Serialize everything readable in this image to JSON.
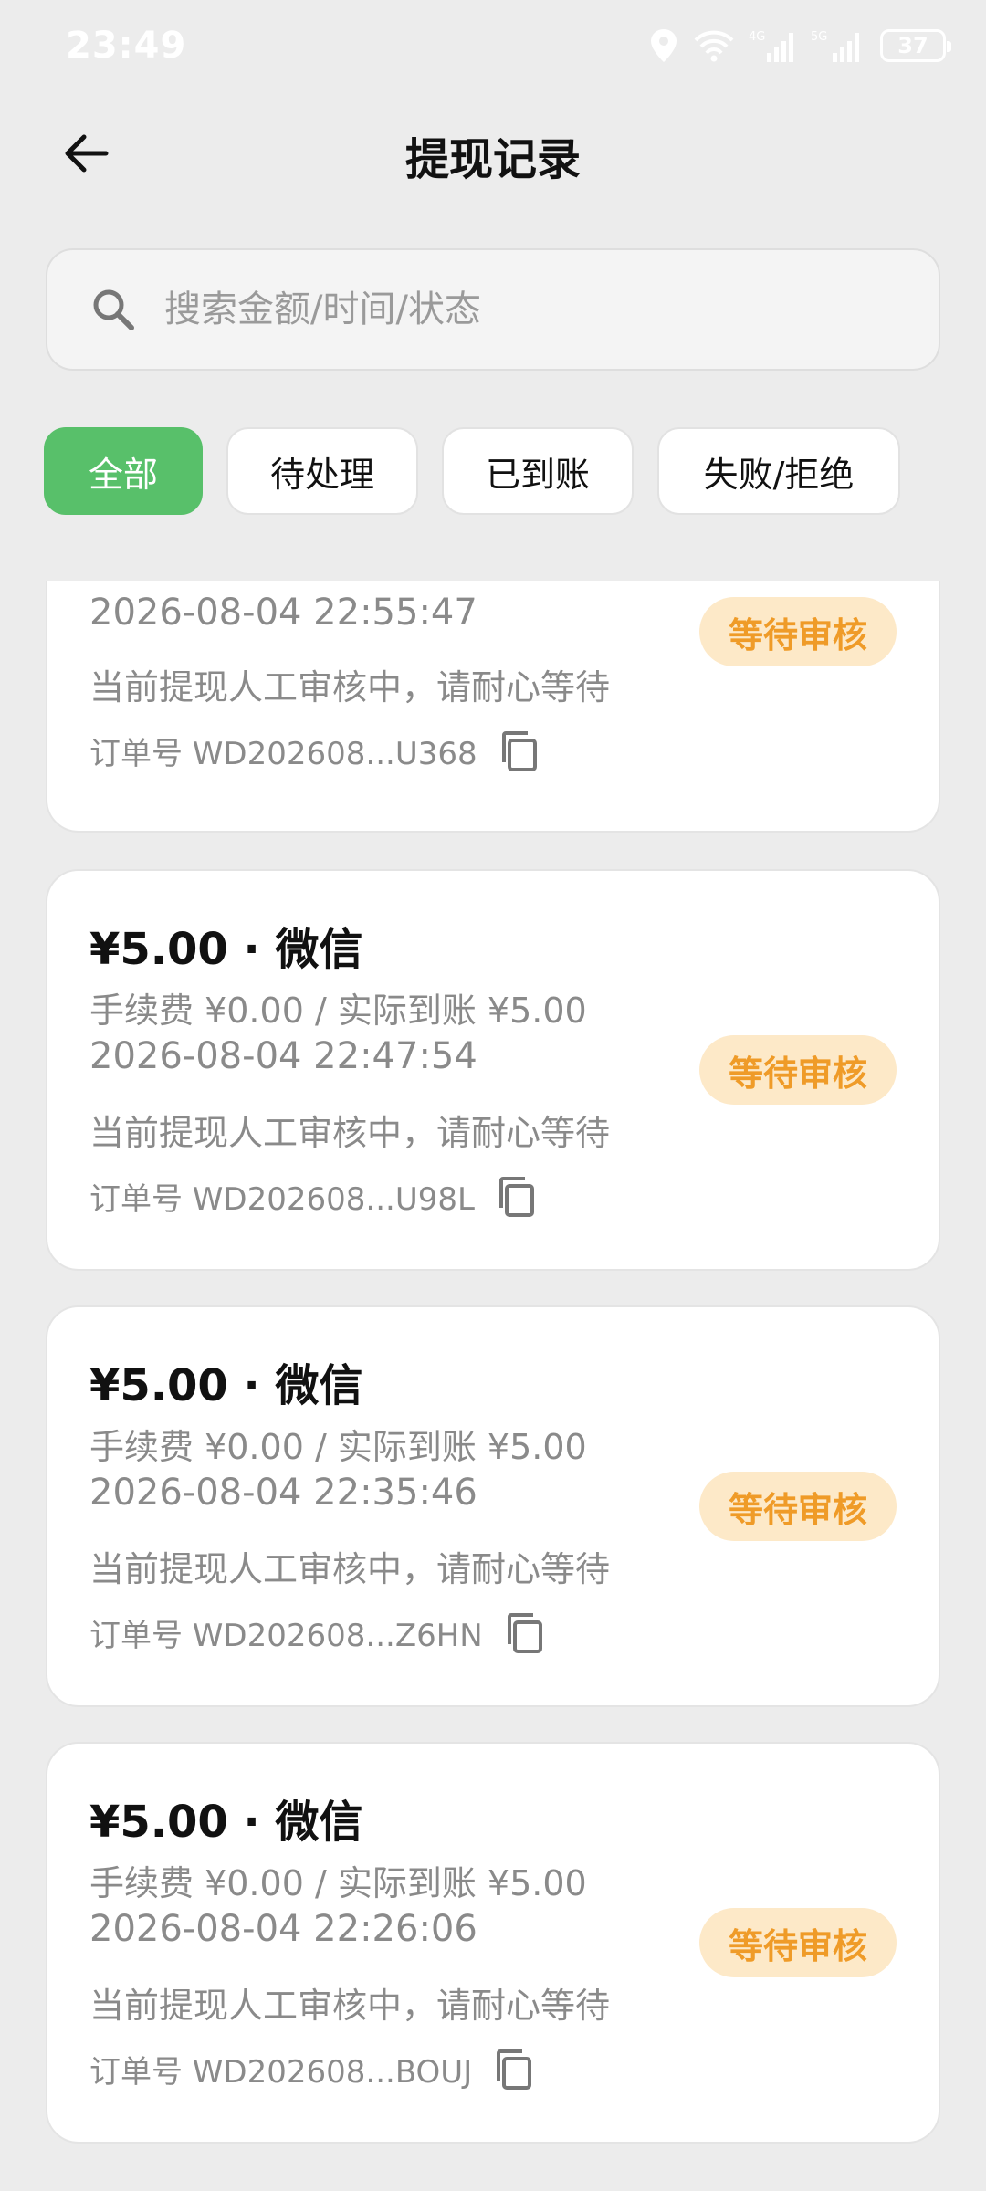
{
  "status_bar": {
    "time": "23:49",
    "battery": "37",
    "icons": [
      "location-icon",
      "wifi-icon",
      "signal-4g-icon",
      "signal-5g-icon",
      "battery-icon"
    ]
  },
  "header": {
    "title": "提现记录",
    "back_icon": "arrow-left-icon"
  },
  "search": {
    "placeholder": "搜索金额/时间/状态",
    "value": ""
  },
  "filters": [
    {
      "label": "全部",
      "active": true
    },
    {
      "label": "待处理",
      "active": false
    },
    {
      "label": "已到账",
      "active": false
    },
    {
      "label": "失败/拒绝",
      "active": false
    }
  ],
  "records": [
    {
      "amount_line": "",
      "fee_line": "",
      "datetime": "2026-08-04 22:55:47",
      "note": "当前提现人工审核中，请耐心等待",
      "order": "订单号 WD202608...U368",
      "status": "等待审核"
    },
    {
      "amount_line": "¥5.00 · 微信",
      "fee_line": "手续费 ¥0.00 / 实际到账 ¥5.00",
      "datetime": "2026-08-04 22:47:54",
      "note": "当前提现人工审核中，请耐心等待",
      "order": "订单号 WD202608...U98L",
      "status": "等待审核"
    },
    {
      "amount_line": "¥5.00 · 微信",
      "fee_line": "手续费 ¥0.00 / 实际到账 ¥5.00",
      "datetime": "2026-08-04 22:35:46",
      "note": "当前提现人工审核中，请耐心等待",
      "order": "订单号 WD202608...Z6HN",
      "status": "等待审核"
    },
    {
      "amount_line": "¥5.00 · 微信",
      "fee_line": "手续费 ¥0.00 / 实际到账 ¥5.00",
      "datetime": "2026-08-04 22:26:06",
      "note": "当前提现人工审核中，请耐心等待",
      "order": "订单号 WD202608...BOUJ",
      "status": "等待审核"
    }
  ],
  "colors": {
    "accent": "#58c06a",
    "badge_bg": "#fde9c8",
    "badge_text": "#ef9b28",
    "background": "#ececec"
  }
}
